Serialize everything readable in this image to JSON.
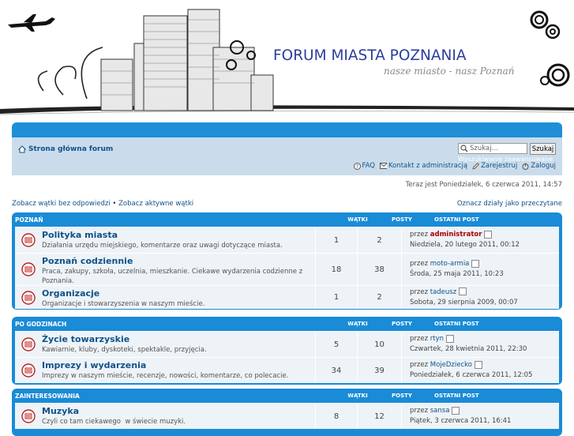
{
  "header": {
    "title": "FORUM MIASTA POZNANIA",
    "slogan": "nasze miasto - nasz Poznań"
  },
  "navbar": {
    "home": "Strona główna forum",
    "search_placeholder": "Szukaj…",
    "search_button": "Szukaj",
    "advanced_search": "Wyszukiwanie zaawansowane",
    "links": {
      "faq": "FAQ",
      "contact": "Kontakt z administracją",
      "register": "Zarejestruj",
      "login": "Zaloguj"
    }
  },
  "time": "Teraz jest Poniedziałek, 6 czerwca 2011, 14:57",
  "links_left": {
    "unanswered": "Zobacz wątki bez odpowiedzi",
    "sep": "•",
    "active": "Zobacz aktywne wątki"
  },
  "links_right": "Oznacz działy jako przeczytane",
  "columns": {
    "topics": "WĄTKI",
    "posts": "POSTY",
    "last": "OSTATNI POST"
  },
  "categories": [
    {
      "name": "POZNAŃ",
      "forums": [
        {
          "name": "Polityka miasta",
          "desc": "Działania urzędu miejskiego, komentarze oraz uwagi dotyczące miasta.",
          "topics": "1",
          "posts": "2",
          "by_prefix": "przez",
          "author": "administrator",
          "date": "Niedziela, 20 lutego 2011, 00:12"
        },
        {
          "name": "Poznań codziennie",
          "desc": "Praca, zakupy, szkoła, uczelnia, mieszkanie. Ciekawe wydarzenia codzienne z Poznania.",
          "topics": "18",
          "posts": "38",
          "by_prefix": "przez",
          "author": "moto-armia",
          "date": "Środa, 25 maja 2011, 10:23"
        },
        {
          "name": "Organizacje",
          "desc": "Organizacje i stowarzyszenia w naszym mieście.",
          "topics": "1",
          "posts": "2",
          "by_prefix": "przez",
          "author": "tadeusz",
          "date": "Sobota, 29 sierpnia 2009, 00:07"
        }
      ]
    },
    {
      "name": "PO GODZINACH",
      "forums": [
        {
          "name": "Życie towarzyskie",
          "desc": "Kawiarnie, kluby, dyskoteki, spektakle, przyjęcia.",
          "topics": "5",
          "posts": "10",
          "by_prefix": "przez",
          "author": "rtyn",
          "date": "Czwartek, 28 kwietnia 2011, 22:30"
        },
        {
          "name": "Imprezy i wydarzenia",
          "desc": "Imprezy w naszym mieście, recenzje, nowości, komentarze, co polecacie.",
          "topics": "34",
          "posts": "39",
          "by_prefix": "przez",
          "author": "MojeDziecko",
          "date": "Poniedziałek, 6 czerwca 2011, 12:05"
        }
      ]
    },
    {
      "name": "ZAINTERESOWANIA",
      "forums": [
        {
          "name": "Muzyka",
          "desc": "Czyli co tam ciekawego  w świecie muzyki.",
          "topics": "8",
          "posts": "12",
          "by_prefix": "przez",
          "author": "sansa",
          "date": "Piątek, 3 czerwca 2011, 16:41"
        }
      ]
    }
  ]
}
